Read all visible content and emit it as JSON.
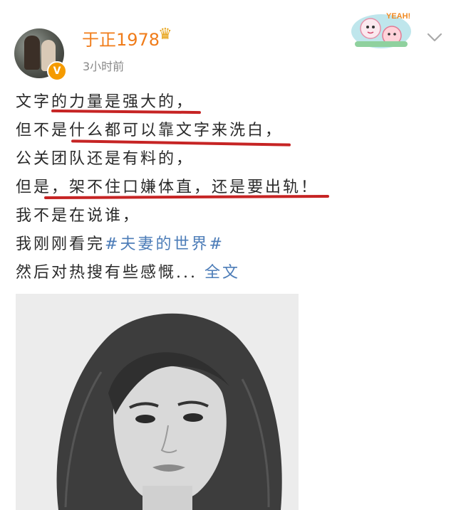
{
  "post": {
    "username": "于正1978",
    "timestamp": "3小时前",
    "verified_glyph": "V",
    "crown_icon": "crown-icon",
    "sticker_text": "YEAH!",
    "lines": [
      "文字的力量是强大的，",
      "但不是什么都可以靠文字来洗白，",
      "公关团队还是有料的，",
      "但是，架不住口嫌体直，还是要出轨！",
      "我不是在说谁，"
    ],
    "line6_prefix": "我刚刚看完",
    "topic": "#夫妻的世界#",
    "line7_prefix": "然后对热搜有些感慨...",
    "more_link": "全文"
  },
  "colors": {
    "username": "#f07c1a",
    "link": "#4d7db8",
    "underline": "#c62424",
    "timestamp": "#888888"
  }
}
